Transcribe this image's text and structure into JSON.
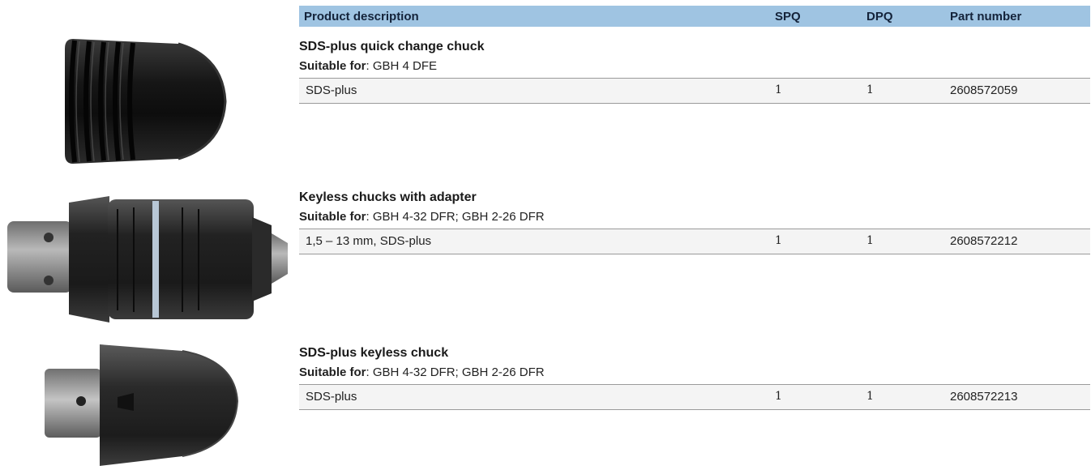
{
  "table": {
    "headers": {
      "description": "Product description",
      "spq": "SPQ",
      "dpq": "DPQ",
      "part_number": "Part number"
    }
  },
  "products": [
    {
      "title": "SDS-plus quick change chuck",
      "suitable_label": "Suitable for",
      "suitable_value": ": GBH 4 DFE",
      "rows": [
        {
          "description": "SDS-plus",
          "spq": "1",
          "dpq": "1",
          "part_number": "2608572059"
        }
      ],
      "image_icon": "sds-plus-quick-change-chuck-icon"
    },
    {
      "title": "Keyless chucks with adapter",
      "suitable_label": "Suitable for",
      "suitable_value": ": GBH 4-32 DFR; GBH 2-26 DFR",
      "rows": [
        {
          "description": "1,5 – 13 mm, SDS-plus",
          "spq": "1",
          "dpq": "1",
          "part_number": "2608572212"
        }
      ],
      "image_icon": "keyless-chuck-with-adapter-icon"
    },
    {
      "title": "SDS-plus keyless chuck",
      "suitable_label": "Suitable for",
      "suitable_value": ": GBH 4-32 DFR; GBH 2-26 DFR",
      "rows": [
        {
          "description": "SDS-plus",
          "spq": "1",
          "dpq": "1",
          "part_number": "2608572213"
        }
      ],
      "image_icon": "sds-plus-keyless-chuck-icon"
    }
  ],
  "colors": {
    "header_bg": "#9fc4e2",
    "row_bg": "#f4f4f4",
    "rule": "#9a9a9a"
  }
}
